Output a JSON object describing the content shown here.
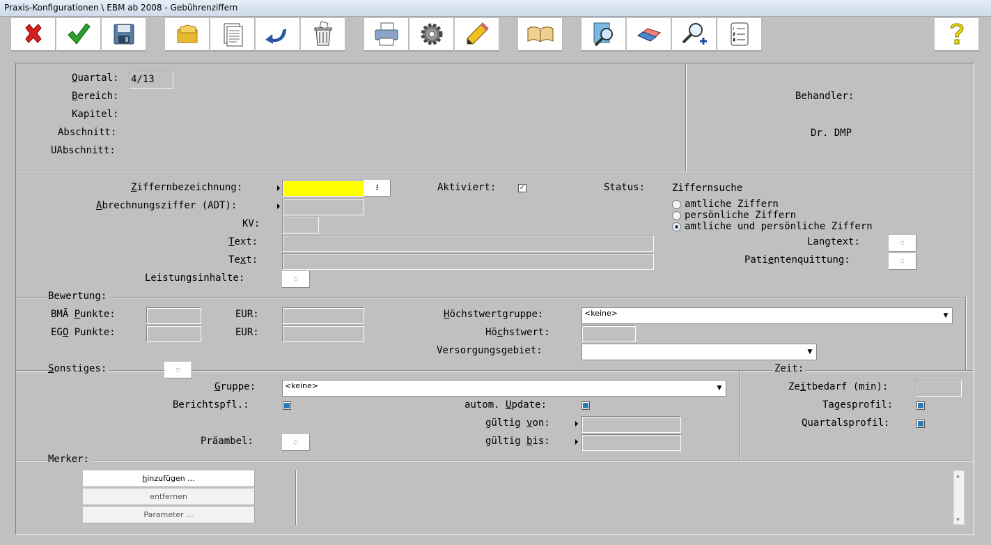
{
  "window": {
    "title": "Praxis-Konfigurationen \\ EBM ab 2008 - Gebührenziffern"
  },
  "toolbar": {
    "icons": [
      "cancel-icon",
      "confirm-icon",
      "save-icon",
      "folders-icon",
      "pages-icon",
      "undo-icon",
      "trash-icon",
      "print-icon",
      "settings-icon",
      "pencil-icon",
      "book-icon",
      "search-document-icon",
      "eraser-icon",
      "zoom-add-icon",
      "list-icon",
      "help-icon"
    ]
  },
  "header": {
    "quartal_label_u": "Q",
    "quartal_label_rest": "uartal:",
    "quartal_value": "4/13",
    "bereich_label_u": "B",
    "bereich_label_rest": "ereich:",
    "kapitel_label": "Kapitel:",
    "abschnitt_label": "Abschnitt:",
    "uabschnitt_label": "UAbschnitt:",
    "behandler_label": "Behandler:",
    "behandler_value": "Dr. DMP"
  },
  "ziffer": {
    "bez_label_u": "Z",
    "bez_label_rest": "iffernbezeichnung:",
    "abr_label_u": "A",
    "abr_label_rest": "brechnungsziffer (ADT):",
    "kv_label": "KV:",
    "text1_label_u": "T",
    "text1_label_rest": "ext:",
    "text2_label_a": "Te",
    "text2_label_u": "x",
    "text2_label_b": "t:",
    "leistung_label": "Leistungsinhalte:",
    "aktiviert_label": "Aktiviert:",
    "status_label": "Status:",
    "suche_title": "Ziffernsuche",
    "suche_options": [
      "amtliche Ziffern",
      "persönliche Ziffern",
      "amtliche und persönliche Ziffern"
    ],
    "langtext_label": "Langtext:",
    "quittung_label_a": "Pati",
    "quittung_label_u": "e",
    "quittung_label_b": "ntenquittung:"
  },
  "bewertung": {
    "title": "Bewertung:",
    "bma_label_a": "BMÄ ",
    "bma_label_u": "P",
    "bma_label_b": "unkte:",
    "ego_label_a": "EG",
    "ego_label_u": "O",
    "ego_label_b": " Punkte:",
    "eur_label": "EUR:",
    "hwg_label_u": "H",
    "hwg_label_rest": "öchstwertgruppe:",
    "hwg_value": "<keine>",
    "hw_label_a": "Hö",
    "hw_label_u": "c",
    "hw_label_b": "hstwert:",
    "versorgung_label": "Versorgungsgebiet:"
  },
  "sonstiges": {
    "title_u": "S",
    "title_rest": "onstiges:",
    "gruppe_label_u": "G",
    "gruppe_label_rest": "ruppe:",
    "gruppe_value": "<keine>",
    "bericht_label": "Berichtspfl.:",
    "praeambel_label": "Präambel:",
    "update_label_a": "autom. ",
    "update_label_u": "U",
    "update_label_b": "pdate:",
    "von_label_a": "gültig ",
    "von_label_u": "v",
    "von_label_b": "on:",
    "bis_label_a": "gültig ",
    "bis_label_u": "b",
    "bis_label_b": "is:"
  },
  "zeit": {
    "title": "Zeit:",
    "bedarf_label_a": "Ze",
    "bedarf_label_u": "i",
    "bedarf_label_b": "tbedarf (min):",
    "tages_label": "Tagesprofil:",
    "quartal_label": "Quartalsprofil:"
  },
  "merker": {
    "title": "Merker:",
    "add_u": "h",
    "add_rest": "inzufügen ...",
    "remove_label": "entfernen",
    "param_label": "Parameter ..."
  }
}
